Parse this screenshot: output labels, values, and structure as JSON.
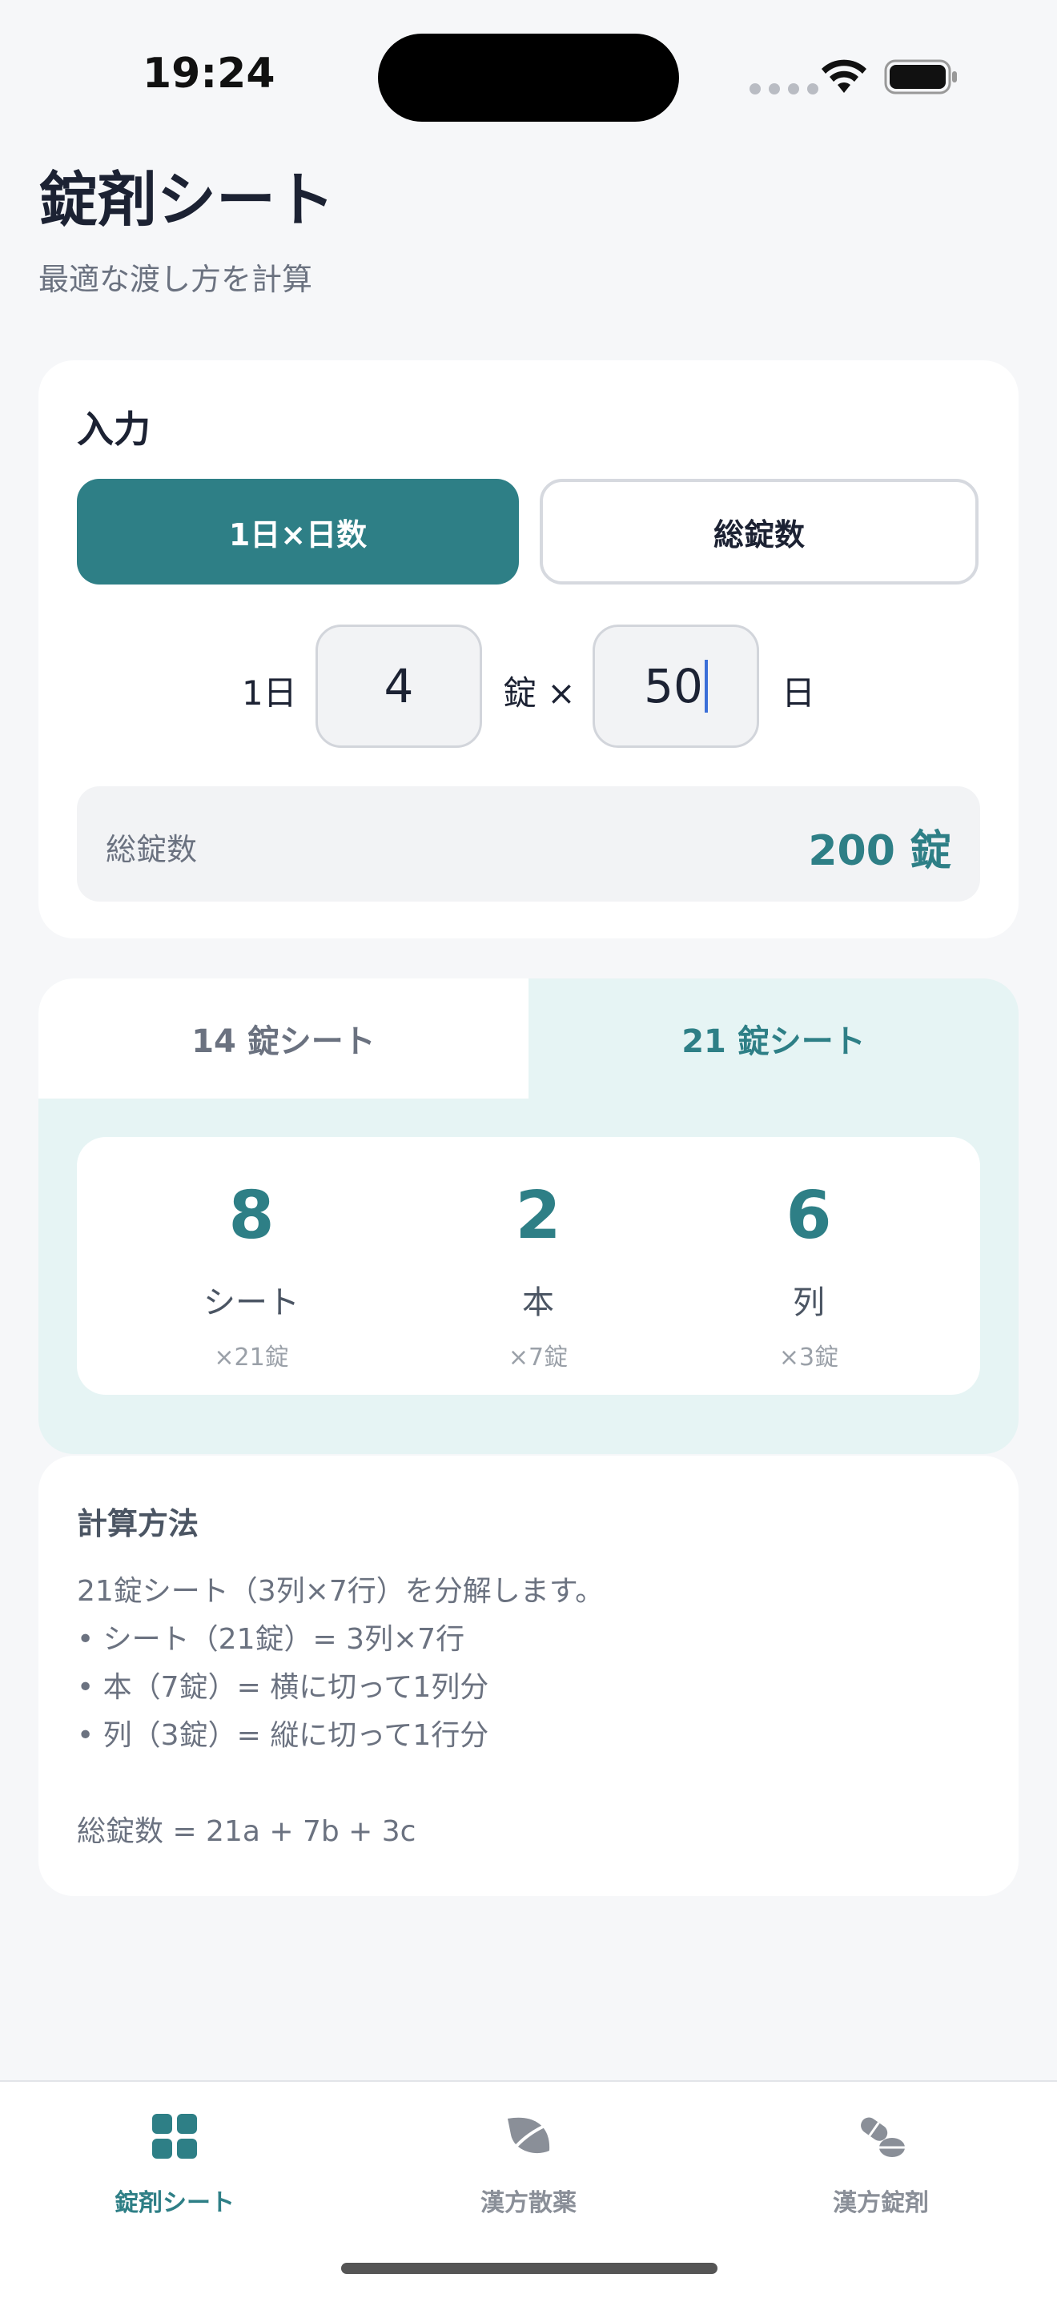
{
  "status_bar": {
    "time": "19:24"
  },
  "header": {
    "title": "錠剤シート",
    "subtitle": "最適な渡し方を計算"
  },
  "input_card": {
    "title": "入力",
    "mode_buttons": [
      "1日×日数",
      "総錠数"
    ],
    "per_day_prefix": "1日",
    "per_day_value": "4",
    "per_day_suffix": "錠 ×",
    "days_value": "50",
    "days_suffix": "日",
    "total_label": "総錠数",
    "total_value": "200 錠"
  },
  "result_card": {
    "tabs": [
      "14 錠シート",
      "21 錠シート"
    ],
    "active_tab": "21 錠シート",
    "results": [
      {
        "count": "8",
        "unit": "シート",
        "detail": "×21錠"
      },
      {
        "count": "2",
        "unit": "本",
        "detail": "×7錠"
      },
      {
        "count": "6",
        "unit": "列",
        "detail": "×3錠"
      }
    ]
  },
  "method_card": {
    "title": "計算方法",
    "body": "21錠シート（3列×7行）を分解します。\n• シート（21錠）= 3列×7行\n• 本（7錠）= 横に切って1列分\n• 列（3錠）= 縦に切って1行分\n\n総錠数 = 21a + 7b + 3c"
  },
  "tab_bar": {
    "items": [
      {
        "label": "錠剤シート",
        "icon": "grid-icon",
        "active": true
      },
      {
        "label": "漢方散薬",
        "icon": "leaf-icon",
        "active": false
      },
      {
        "label": "漢方錠剤",
        "icon": "pill-icon",
        "active": false
      }
    ]
  },
  "colors": {
    "accent": "#2e7f86",
    "accent_bg": "#e6f4f4",
    "muted": "#6b7280"
  }
}
